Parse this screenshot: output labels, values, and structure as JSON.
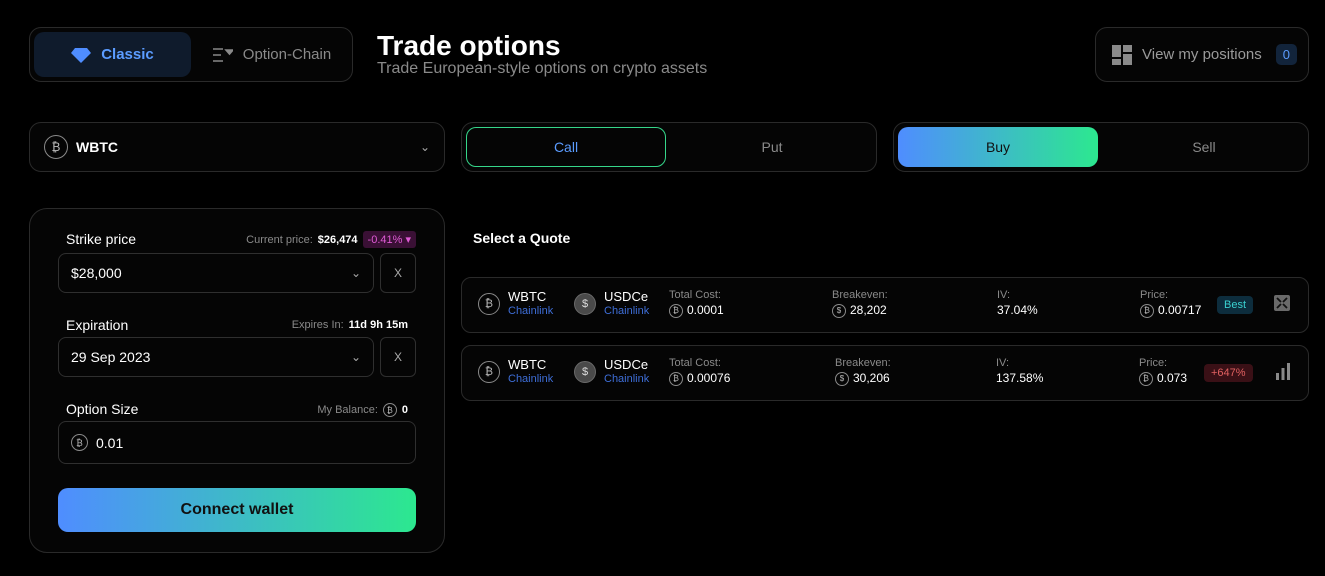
{
  "mode": {
    "classic": "Classic",
    "chain": "Option-Chain"
  },
  "header": {
    "title": "Trade options",
    "subtitle": "Trade European-style options on crypto assets"
  },
  "positions": {
    "label": "View my positions",
    "count": "0"
  },
  "asset": {
    "name": "WBTC"
  },
  "option_type": {
    "call": "Call",
    "put": "Put"
  },
  "side": {
    "buy": "Buy",
    "sell": "Sell"
  },
  "form": {
    "strike_label": "Strike price",
    "current_price_label": "Current price:",
    "current_price": "$26,474",
    "change": "-0.41%",
    "strike_value": "$28,000",
    "clear": "X",
    "expiration_label": "Expiration",
    "expires_in_label": "Expires In:",
    "expires_in": "11d 9h 15m",
    "expiration_value": "29 Sep 2023",
    "size_label": "Option Size",
    "balance_label": "My Balance:",
    "balance": "0",
    "size_value": "0.01",
    "connect": "Connect wallet"
  },
  "quotes": {
    "title": "Select a Quote",
    "items": [
      {
        "base": "WBTC",
        "base_src": "Chainlink",
        "quote": "USDCe",
        "quote_src": "Chainlink",
        "cost_label": "Total Cost:",
        "cost": "0.0001",
        "be_label": "Breakeven:",
        "be": "28,202",
        "iv_label": "IV:",
        "iv": "37.04%",
        "price_label": "Price:",
        "price": "0.00717",
        "tag": "Best"
      },
      {
        "base": "WBTC",
        "base_src": "Chainlink",
        "quote": "USDCe",
        "quote_src": "Chainlink",
        "cost_label": "Total Cost:",
        "cost": "0.00076",
        "be_label": "Breakeven:",
        "be": "30,206",
        "iv_label": "IV:",
        "iv": "137.58%",
        "price_label": "Price:",
        "price": "0.073",
        "tag": "+647%"
      }
    ]
  },
  "colors": {
    "accent_blue": "#4f8dff",
    "accent_green": "#2ce88f",
    "negative": "#e05bd6"
  }
}
